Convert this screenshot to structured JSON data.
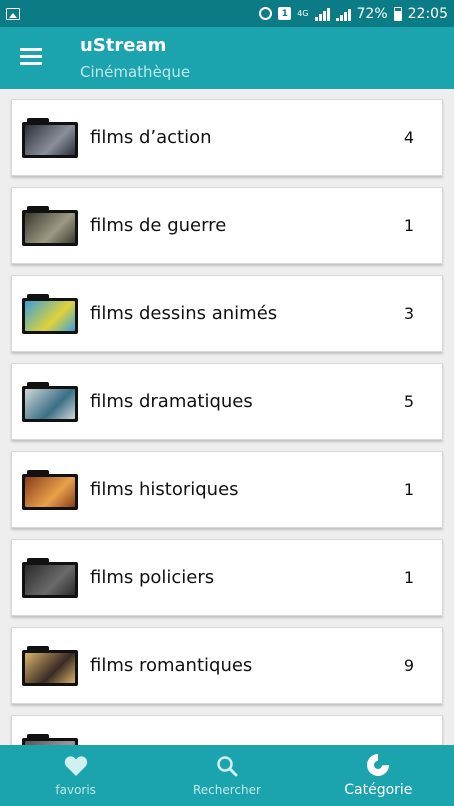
{
  "status_bar": {
    "battery": "72%",
    "time": "22:05",
    "network": "4G",
    "notification_badge": "1"
  },
  "app_bar": {
    "title": "uStream",
    "subtitle": "Cinémathèque",
    "menu_icon": "hamburger-menu-icon"
  },
  "categories": [
    {
      "label": "films d’action",
      "count": "4",
      "thumb_colors": [
        "#2b2f3a",
        "#8a8f99"
      ]
    },
    {
      "label": "films de guerre",
      "count": "1",
      "thumb_colors": [
        "#3b3a2c",
        "#9c9a84"
      ]
    },
    {
      "label": "films dessins animés",
      "count": "3",
      "thumb_colors": [
        "#3aa0d8",
        "#e0d23a"
      ]
    },
    {
      "label": "films dramatiques",
      "count": "5",
      "thumb_colors": [
        "#cfd6d8",
        "#3b6f86"
      ]
    },
    {
      "label": "films historiques",
      "count": "1",
      "thumb_colors": [
        "#8a3b1c",
        "#e8a24a"
      ]
    },
    {
      "label": "films policiers",
      "count": "1",
      "thumb_colors": [
        "#2a2a2a",
        "#6a6a6a"
      ]
    },
    {
      "label": "films romantiques",
      "count": "9",
      "thumb_colors": [
        "#d8b46a",
        "#3a2a24"
      ]
    },
    {
      "label": "",
      "count": "",
      "thumb_colors": [
        "#555555",
        "#999999"
      ]
    }
  ],
  "bottom_nav": {
    "items": [
      {
        "label": "favoris",
        "icon": "heart-icon",
        "active": false
      },
      {
        "label": "Rechercher",
        "icon": "search-icon",
        "active": false
      },
      {
        "label": "Catégorie",
        "icon": "category-pie-icon",
        "active": true
      }
    ]
  },
  "colors": {
    "status_bar": "#0b7c86",
    "app_bar": "#1ba3ae",
    "background": "#eeeeee"
  }
}
